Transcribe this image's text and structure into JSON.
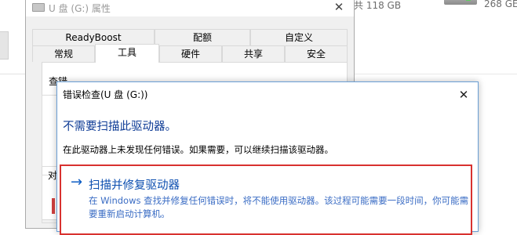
{
  "background": {
    "drive1_size": "共 118 GB",
    "drive2_size": "268 GE"
  },
  "props_dialog": {
    "title": "U 盘 (G:) 属性",
    "tabs_row1": [
      "ReadyBoost",
      "配额",
      "自定义"
    ],
    "tabs_row2": [
      "常规",
      "工具",
      "硬件",
      "共享",
      "安全"
    ],
    "active_tab": "工具",
    "section_fragment": "查错",
    "group_fragment": "对"
  },
  "error_dialog": {
    "title": "错误检查(U 盘 (G:))",
    "heading": "不需要扫描此驱动器。",
    "body": "在此驱动器上未发现任何错误。如果需要，可以继续扫描该驱动器。",
    "option": {
      "label": "扫描并修复驱动器",
      "description": "在 Windows 查找并修复任何错误时，将不能使用驱动器。该过程可能需要一段时间，你可能需要重新启动计算机。"
    }
  },
  "colors": {
    "heading": "#0f3c96",
    "option_link": "#0d4fb0",
    "highlight_border": "#d8312f"
  }
}
